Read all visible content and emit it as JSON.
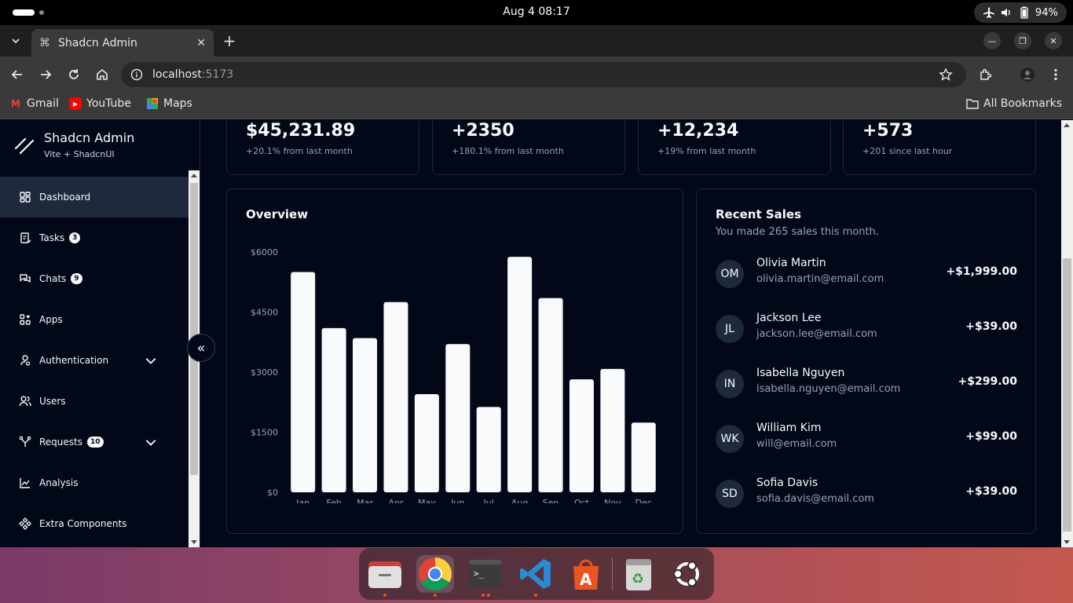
{
  "os": {
    "clock": "Aug 4  08:17",
    "battery": "94%"
  },
  "browser": {
    "tab_title": "Shadcn Admin",
    "url_host": "localhost",
    "url_port": ":5173",
    "bookmarks": [
      "Gmail",
      "YouTube",
      "Maps"
    ],
    "all_bookmarks": "All Bookmarks"
  },
  "brand": {
    "name": "Shadcn Admin",
    "subtitle": "Vite + ShadcnUI"
  },
  "nav": [
    {
      "label": "Dashboard",
      "icon": "dashboard-icon"
    },
    {
      "label": "Tasks",
      "badge": "3",
      "icon": "tasks-icon"
    },
    {
      "label": "Chats",
      "badge": "9",
      "icon": "chats-icon"
    },
    {
      "label": "Apps",
      "icon": "apps-icon"
    },
    {
      "label": "Authentication",
      "icon": "user-icon"
    },
    {
      "label": "Users",
      "icon": "users-icon"
    },
    {
      "label": "Requests",
      "badge": "10",
      "icon": "requests-icon"
    },
    {
      "label": "Analysis",
      "icon": "analysis-icon"
    },
    {
      "label": "Extra Components",
      "icon": "components-icon"
    }
  ],
  "stats": [
    {
      "value": "$45,231.89",
      "sub": "+20.1% from last month"
    },
    {
      "value": "+2350",
      "sub": "+180.1% from last month"
    },
    {
      "value": "+12,234",
      "sub": "+19% from last month"
    },
    {
      "value": "+573",
      "sub": "+201 since last hour"
    }
  ],
  "overview": {
    "title": "Overview"
  },
  "chart_data": {
    "type": "bar",
    "categories": [
      "Jan",
      "Feb",
      "Mar",
      "Apr",
      "May",
      "Jun",
      "Jul",
      "Aug",
      "Sep",
      "Oct",
      "Nov",
      "Dec"
    ],
    "values": [
      5500,
      4100,
      3850,
      4750,
      2450,
      3700,
      2130,
      5880,
      4850,
      2820,
      3080,
      1740
    ],
    "yticks": [
      "$0",
      "$1500",
      "$3000",
      "$4500",
      "$6000"
    ],
    "ylim": [
      0,
      6000
    ],
    "title": "Overview",
    "xlabel": "",
    "ylabel": "",
    "bar_color": "#f8fafc"
  },
  "sales": {
    "title": "Recent Sales",
    "description": "You made 265 sales this month.",
    "rows": [
      {
        "initials": "OM",
        "name": "Olivia Martin",
        "email": "olivia.martin@email.com",
        "amount": "+$1,999.00"
      },
      {
        "initials": "JL",
        "name": "Jackson Lee",
        "email": "jackson.lee@email.com",
        "amount": "+$39.00"
      },
      {
        "initials": "IN",
        "name": "Isabella Nguyen",
        "email": "isabella.nguyen@email.com",
        "amount": "+$299.00"
      },
      {
        "initials": "WK",
        "name": "William Kim",
        "email": "will@email.com",
        "amount": "+$99.00"
      },
      {
        "initials": "SD",
        "name": "Sofia Davis",
        "email": "sofia.davis@email.com",
        "amount": "+$39.00"
      }
    ]
  },
  "dock": [
    "files-icon",
    "chrome-icon",
    "terminal-icon",
    "vscode-icon",
    "app-center-icon",
    "trash-icon",
    "ubuntu-icon"
  ]
}
